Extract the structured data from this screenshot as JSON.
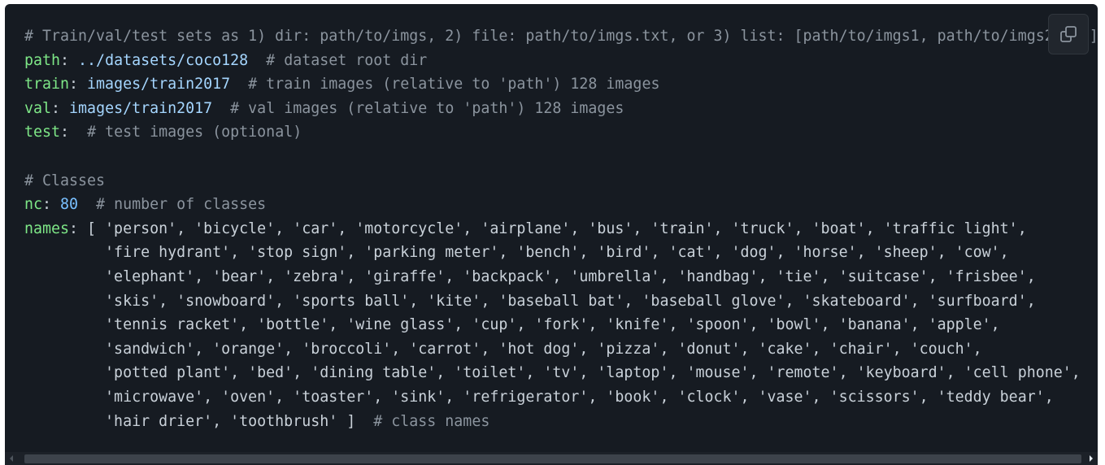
{
  "code": {
    "lines": [
      [
        {
          "t": "# Train/val/test sets as 1) dir: path/to/imgs, 2) file: path/to/imgs.txt, or 3) list: [path/to/imgs1, path/to/imgs2, ..]",
          "c": "cm"
        }
      ],
      [
        {
          "t": "path",
          "c": "key"
        },
        {
          "t": ": ",
          "c": "pl"
        },
        {
          "t": "../datasets/coco128",
          "c": "str"
        },
        {
          "t": "  # dataset root dir",
          "c": "cm"
        }
      ],
      [
        {
          "t": "train",
          "c": "key"
        },
        {
          "t": ": ",
          "c": "pl"
        },
        {
          "t": "images/train2017",
          "c": "str"
        },
        {
          "t": "  # train images (relative to 'path') 128 images",
          "c": "cm"
        }
      ],
      [
        {
          "t": "val",
          "c": "key"
        },
        {
          "t": ": ",
          "c": "pl"
        },
        {
          "t": "images/train2017",
          "c": "str"
        },
        {
          "t": "  # val images (relative to 'path') 128 images",
          "c": "cm"
        }
      ],
      [
        {
          "t": "test",
          "c": "key"
        },
        {
          "t": ":  ",
          "c": "pl"
        },
        {
          "t": "# test images (optional)",
          "c": "cm"
        }
      ],
      [],
      [
        {
          "t": "# Classes",
          "c": "cm"
        }
      ],
      [
        {
          "t": "nc",
          "c": "key"
        },
        {
          "t": ": ",
          "c": "pl"
        },
        {
          "t": "80",
          "c": "num"
        },
        {
          "t": "  # number of classes",
          "c": "cm"
        }
      ],
      [
        {
          "t": "names",
          "c": "key"
        },
        {
          "t": ": [ 'person', 'bicycle', 'car', 'motorcycle', 'airplane', 'bus', 'train', 'truck', 'boat', 'traffic light',",
          "c": "pl"
        }
      ],
      [
        {
          "t": "         'fire hydrant', 'stop sign', 'parking meter', 'bench', 'bird', 'cat', 'dog', 'horse', 'sheep', 'cow',",
          "c": "pl"
        }
      ],
      [
        {
          "t": "         'elephant', 'bear', 'zebra', 'giraffe', 'backpack', 'umbrella', 'handbag', 'tie', 'suitcase', 'frisbee',",
          "c": "pl"
        }
      ],
      [
        {
          "t": "         'skis', 'snowboard', 'sports ball', 'kite', 'baseball bat', 'baseball glove', 'skateboard', 'surfboard',",
          "c": "pl"
        }
      ],
      [
        {
          "t": "         'tennis racket', 'bottle', 'wine glass', 'cup', 'fork', 'knife', 'spoon', 'bowl', 'banana', 'apple',",
          "c": "pl"
        }
      ],
      [
        {
          "t": "         'sandwich', 'orange', 'broccoli', 'carrot', 'hot dog', 'pizza', 'donut', 'cake', 'chair', 'couch',",
          "c": "pl"
        }
      ],
      [
        {
          "t": "         'potted plant', 'bed', 'dining table', 'toilet', 'tv', 'laptop', 'mouse', 'remote', 'keyboard', 'cell phone',",
          "c": "pl"
        }
      ],
      [
        {
          "t": "         'microwave', 'oven', 'toaster', 'sink', 'refrigerator', 'book', 'clock', 'vase', 'scissors', 'teddy bear',",
          "c": "pl"
        }
      ],
      [
        {
          "t": "         'hair drier', 'toothbrush' ]",
          "c": "pl"
        },
        {
          "t": "  # class names",
          "c": "cm"
        }
      ]
    ]
  },
  "copy_button": {
    "icon": "copy-icon"
  },
  "scrollbar": {
    "left_icon": "arrow-left-icon",
    "right_icon": "arrow-right-icon"
  },
  "colors": {
    "background": "#161b22",
    "comment": "#8b949e",
    "key": "#7ee787",
    "string": "#a5d6ff",
    "number": "#79c0ff",
    "plain": "#c9d1d9"
  }
}
